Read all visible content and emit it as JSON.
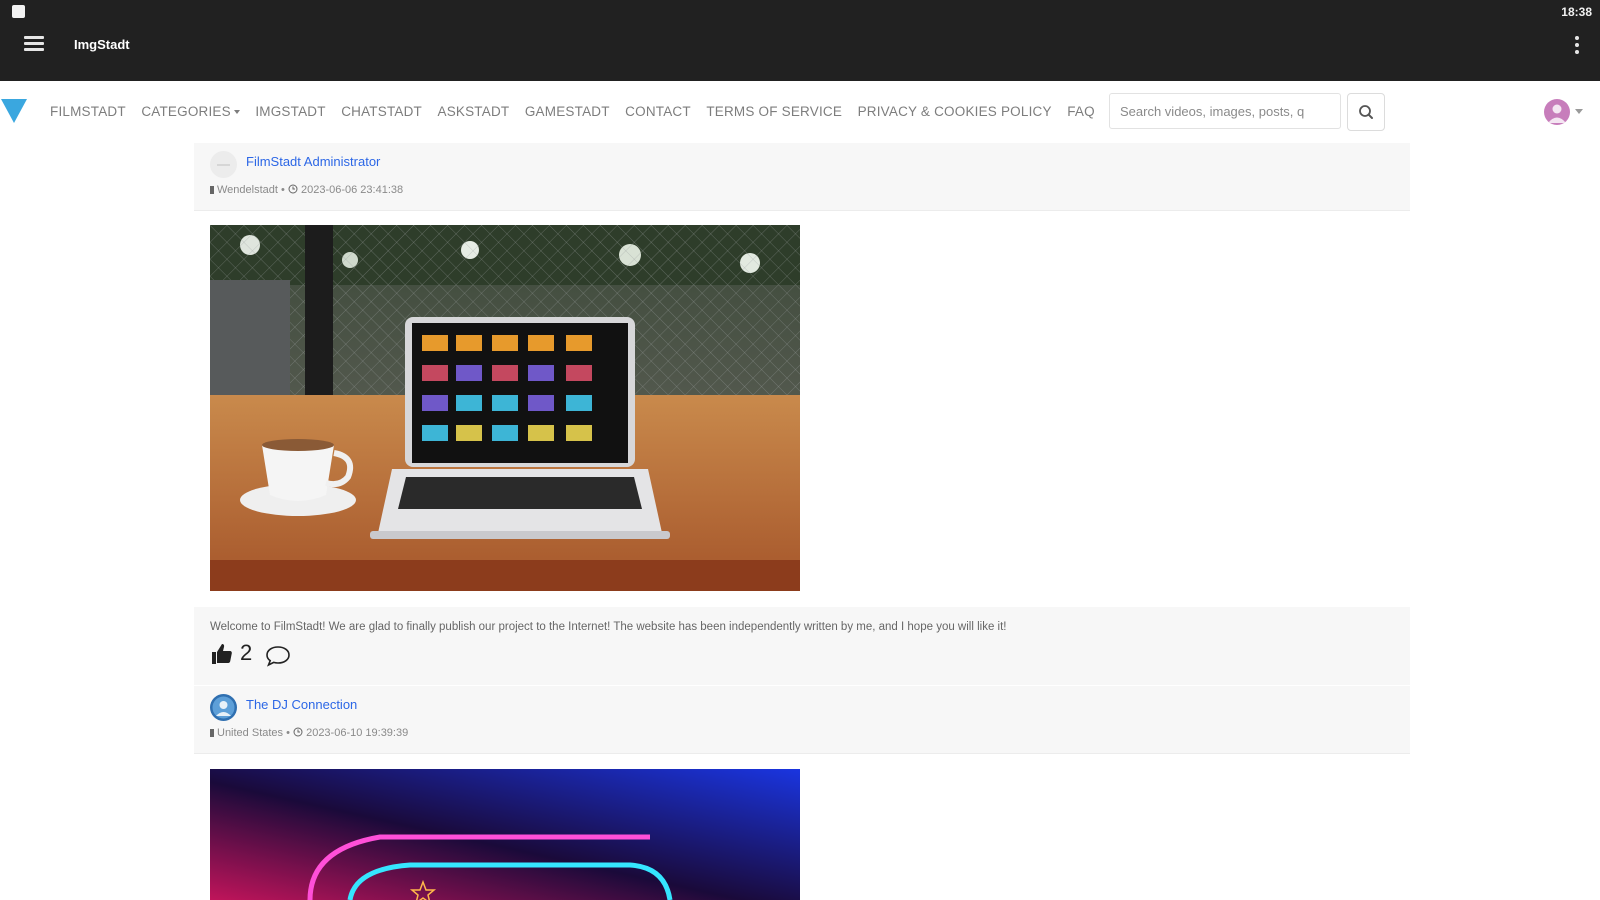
{
  "statusbar": {
    "time": "18:38"
  },
  "appbar": {
    "title": "ImgStadt",
    "menu_icon": "hamburger-menu-icon",
    "overflow_icon": "more-vert-icon"
  },
  "nav": {
    "links": [
      "FILMSTADT",
      "CATEGORIES",
      "IMGSTADT",
      "CHATSTADT",
      "ASKSTADT",
      "GAMESTADT",
      "CONTACT",
      "TERMS OF SERVICE",
      "PRIVACY & COOKIES POLICY",
      "FAQ"
    ],
    "search_placeholder": "Search videos, images, posts, q"
  },
  "posts": [
    {
      "author": "FilmStadt Administrator",
      "location": "Wendelstadt",
      "timestamp": "2023-06-06 23:41:38",
      "text": "Welcome to FilmStadt! We are glad to finally publish our project to the Internet! The website has been independently written by me, and I hope you will like it!",
      "likes": "2"
    },
    {
      "author": "The DJ Connection",
      "location": "United States",
      "timestamp": "2023-06-10 19:39:39"
    }
  ],
  "colors": {
    "appbar": "#212121",
    "link": "#2c67e6",
    "logo": "#3aa7df",
    "avatar": "#c77dbb"
  }
}
